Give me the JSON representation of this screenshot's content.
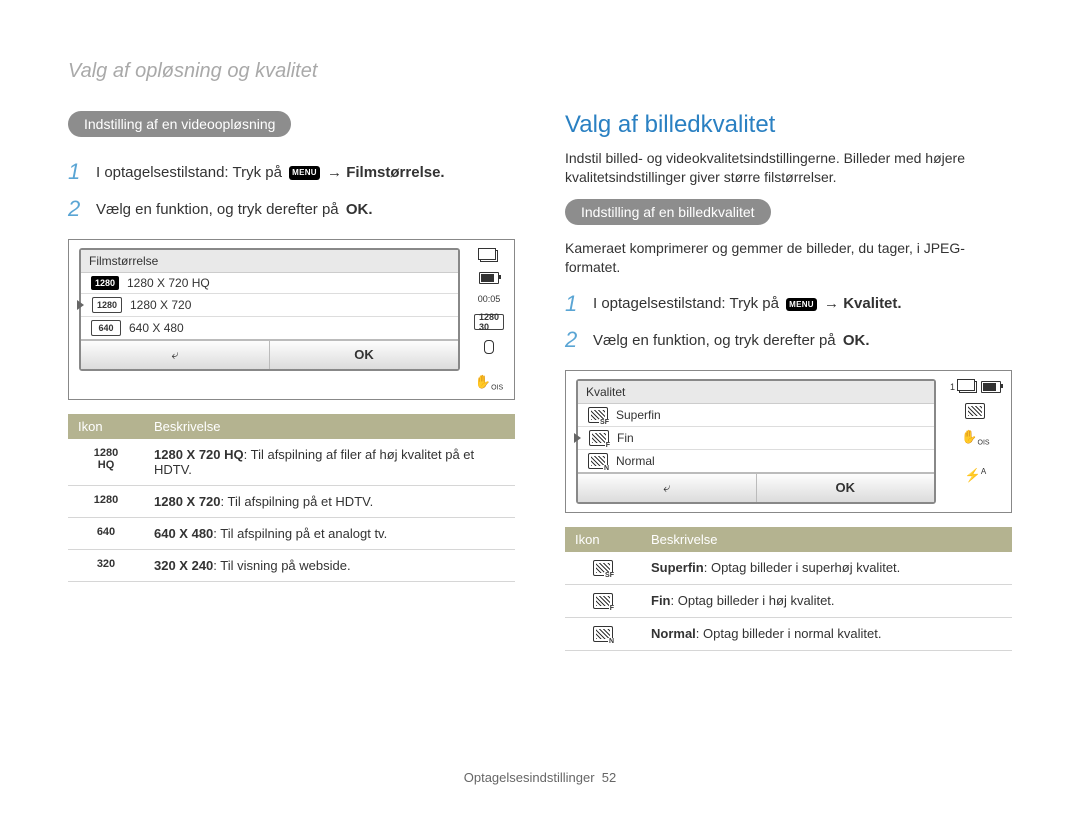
{
  "page_subtitle": "Valg af opløsning og kvalitet",
  "left": {
    "pill": "Indstilling af en videoopløsning",
    "step1_pre": "I optagelsestilstand: Tryk på ",
    "step1_menu": "MENU",
    "step1_post": " → Filmstørrelse.",
    "step2_pre": "Vælg en funktion, og tryk derefter på ",
    "step2_ok": "OK.",
    "cam": {
      "title": "Filmstørrelse",
      "side_time": "00:05",
      "rows": [
        {
          "icon": "1280 HQ",
          "label": "1280 X 720 HQ",
          "selected": true,
          "iconstyle": "black"
        },
        {
          "icon": "1280",
          "label": "1280 X 720",
          "selected": false,
          "iconstyle": "out",
          "pointer": true
        },
        {
          "icon": "640",
          "label": "640 X 480",
          "selected": false,
          "iconstyle": "out"
        }
      ],
      "back": "⤶",
      "ok": "OK"
    },
    "table": {
      "h1": "Ikon",
      "h2": "Beskrivelse",
      "rows": [
        {
          "icon": "1280\nHQ",
          "text": "1280 X 720 HQ: Til afspilning af filer af høj kvalitet på et HDTV.",
          "bold": "1280 X 720 HQ"
        },
        {
          "icon": "1280",
          "text": "1280 X 720: Til afspilning på et HDTV.",
          "bold": "1280 X 720"
        },
        {
          "icon": "640",
          "text": "640 X 480: Til afspilning på et analogt tv.",
          "bold": "640 X 480"
        },
        {
          "icon": "320",
          "text": "320 X 240: Til visning på webside.",
          "bold": "320 X 240"
        }
      ]
    }
  },
  "right": {
    "heading": "Valg af billedkvalitet",
    "intro": "Indstil billed- og videokvalitetsindstillingerne. Billeder med højere kvalitetsindstillinger giver større filstørrelser.",
    "pill": "Indstilling af en billedkvalitet",
    "para": "Kameraet komprimerer og gemmer de billeder, du tager, i JPEG-formatet.",
    "step1_pre": "I optagelsestilstand: Tryk på ",
    "step1_menu": "MENU",
    "step1_post": " → Kvalitet.",
    "step2_pre": "Vælg en funktion, og tryk derefter på ",
    "step2_ok": "OK.",
    "cam": {
      "title": "Kvalitet",
      "side_count": "1",
      "rows": [
        {
          "sub": "SF",
          "label": "Superfin"
        },
        {
          "sub": "F",
          "label": "Fin",
          "pointer": true
        },
        {
          "sub": "N",
          "label": "Normal"
        }
      ],
      "back": "⤶",
      "ok": "OK"
    },
    "table": {
      "h1": "Ikon",
      "h2": "Beskrivelse",
      "rows": [
        {
          "sub": "SF",
          "text": "Superfin: Optag billeder i superhøj kvalitet.",
          "bold": "Superfin"
        },
        {
          "sub": "F",
          "text": "Fin: Optag billeder i høj kvalitet.",
          "bold": "Fin"
        },
        {
          "sub": "N",
          "text": "Normal: Optag billeder i normal kvalitet.",
          "bold": "Normal"
        }
      ]
    }
  },
  "footer_label": "Optagelsesindstillinger",
  "footer_page": "52"
}
